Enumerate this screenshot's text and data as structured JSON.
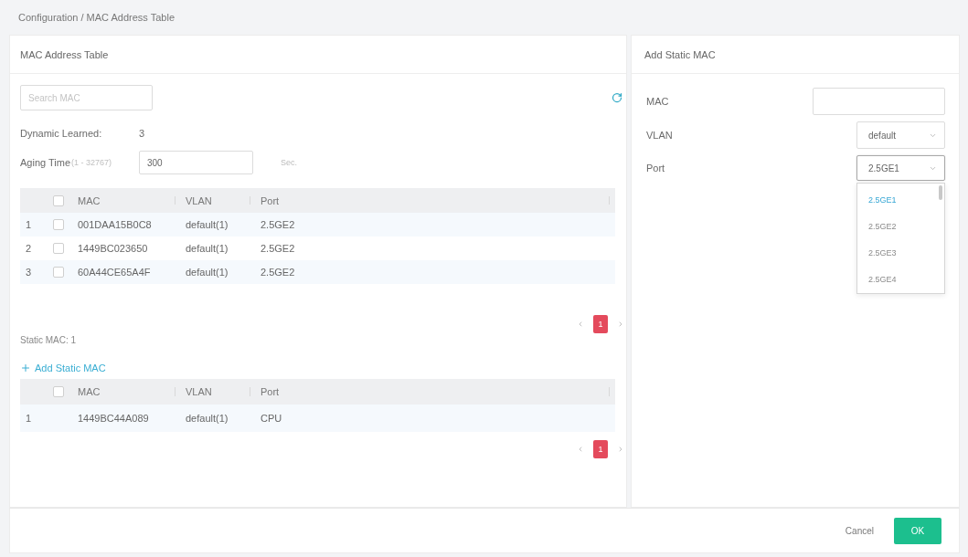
{
  "breadcrumb": "Configuration / MAC Address Table",
  "mac_panel": {
    "title": "MAC Address Table",
    "search": {
      "placeholder": "Search MAC"
    },
    "dynamic_learned": {
      "label": "Dynamic Learned:",
      "value": "3"
    },
    "aging_time": {
      "label": "Aging Time",
      "range": "(1 - 32767)",
      "value": "300",
      "unit": "Sec."
    },
    "dynamic_table": {
      "all_checked": false,
      "columns": [
        "MAC",
        "VLAN",
        "Port"
      ],
      "rows": [
        {
          "index": "1",
          "checked": false,
          "mac": "001DAA15B0C8",
          "vlan": "default(1)",
          "port": "2.5GE2"
        },
        {
          "index": "2",
          "checked": false,
          "mac": "1449BC023650",
          "vlan": "default(1)",
          "port": "2.5GE2"
        },
        {
          "index": "3",
          "checked": false,
          "mac": "60A44CE65A4F",
          "vlan": "default(1)",
          "port": "2.5GE2"
        }
      ],
      "pagination": {
        "pages": [
          {
            "label": "1",
            "selected": true
          }
        ]
      }
    },
    "static_count": "Static MAC: 1",
    "add_static_link": "Add Static MAC",
    "static_table": {
      "all_checked": false,
      "columns": [
        "MAC",
        "VLAN",
        "Port"
      ],
      "rows": [
        {
          "index": "1",
          "mac": "1449BC44A089",
          "vlan": "default(1)",
          "port": "CPU"
        }
      ],
      "pagination": {
        "pages": [
          {
            "label": "1",
            "selected": true
          }
        ]
      }
    }
  },
  "add_panel": {
    "title": "Add Static MAC",
    "fields": [
      {
        "kind": "input",
        "label": "MAC"
      },
      {
        "kind": "select",
        "label": "VLAN",
        "value": "default",
        "expanded": false
      },
      {
        "kind": "select",
        "label": "Port",
        "value": "2.5GE1",
        "expanded": true,
        "options": [
          {
            "label": "2.5GE1",
            "selected": true
          },
          {
            "label": "2.5GE2",
            "selected": false
          },
          {
            "label": "2.5GE3",
            "selected": false
          },
          {
            "label": "2.5GE4",
            "selected": false
          }
        ]
      }
    ]
  },
  "footer": {
    "buttons": [
      {
        "kind": "secondary",
        "label": "Cancel"
      },
      {
        "kind": "primary",
        "label": "OK"
      }
    ]
  }
}
